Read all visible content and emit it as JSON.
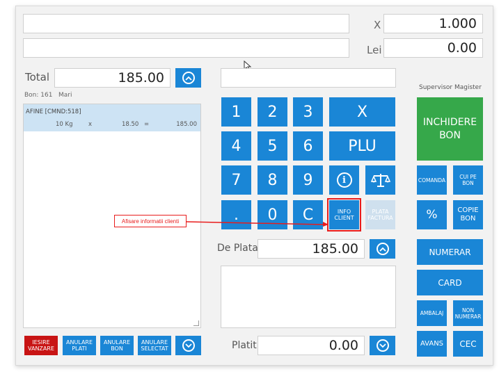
{
  "top": {
    "x_label": "X",
    "x_value": "1.000",
    "lei_label": "Lei",
    "lei_value": "0.00"
  },
  "total": {
    "label": "Total",
    "value": "185.00"
  },
  "bon": {
    "label": "Bon: 161",
    "user": "Mari"
  },
  "receipt": {
    "items": [
      {
        "name": "AFINE [CMND:518]",
        "qty": "10 Kg",
        "x": "x",
        "price": "18.50",
        "eq": "=",
        "total": "185.00"
      }
    ]
  },
  "keypad": {
    "digits": [
      "1",
      "2",
      "3",
      "4",
      "5",
      "6",
      "7",
      "8",
      "9",
      ".",
      "0",
      "C"
    ],
    "x": "X",
    "plu": "PLU",
    "info_client": "INFO CLIENT",
    "plata_factura": "PLATA FACTURA"
  },
  "payment": {
    "de_plata_label": "De Plata",
    "de_plata_value": "185.00",
    "platit_label": "Platit",
    "platit_value": "0.00"
  },
  "right": {
    "supervisor": "Supervisor Magister",
    "inchidere_bon": "INCHIDERE BON",
    "comanda": "COMANDA",
    "cui_pe_bon": "CUI PE BON",
    "percent": "%",
    "copie_bon": "COPIE BON",
    "numerar": "NUMERAR",
    "card": "CARD",
    "ambalaj": "AMBALAJ",
    "non_numerar": "NON NUMERAR",
    "avans": "AVANS",
    "cec": "CEC"
  },
  "bottom": {
    "iesire_vanzare": "IESIRE VANZARE",
    "anulare_plati": "ANULARE PLATI",
    "anulare_bon": "ANULARE BON",
    "anulare_selectat": "ANULARE SELECTAT"
  },
  "annotation": {
    "text": "Afisare informatii clienti"
  },
  "colors": {
    "accent": "#1a86d6",
    "green": "#36a84a",
    "red": "#c81414",
    "annotation": "#e81c1c"
  }
}
